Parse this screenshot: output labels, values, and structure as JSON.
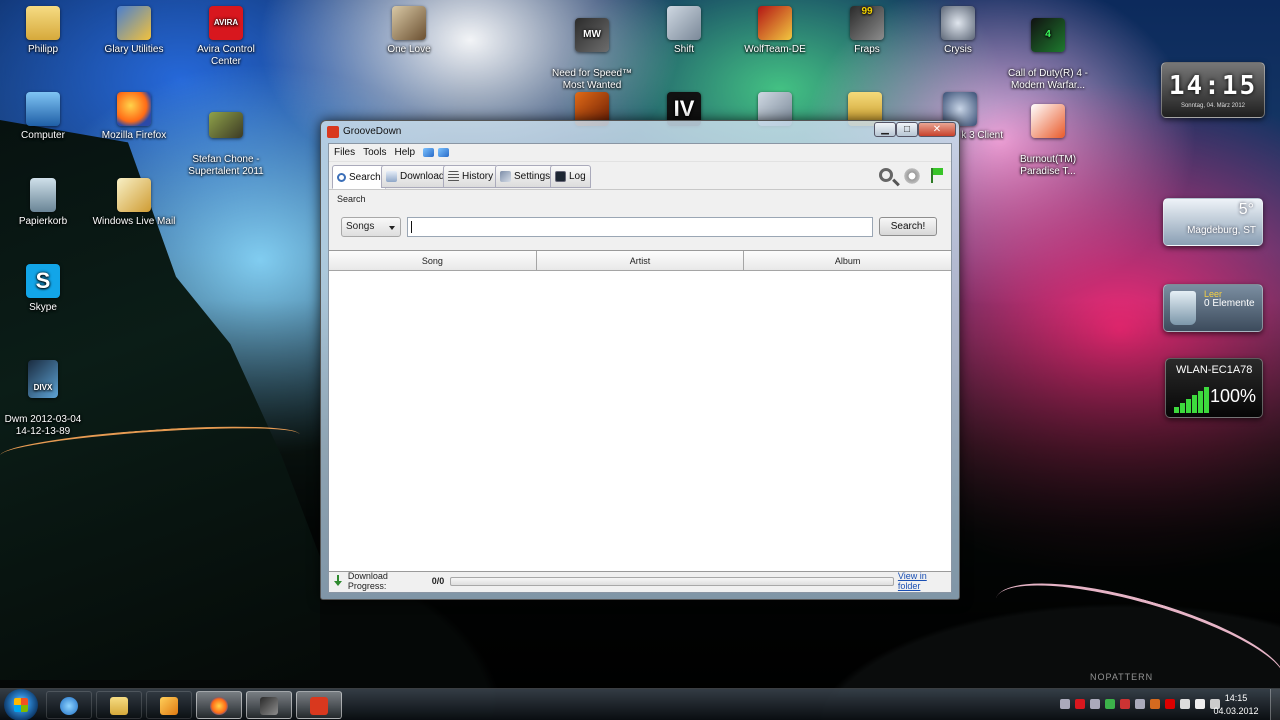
{
  "desktop": {
    "icons": [
      {
        "label": "Philipp",
        "icon": "user-folder-icon"
      },
      {
        "label": "Glary Utilities",
        "icon": "glary-utilities-icon"
      },
      {
        "label": "Avira Control Center",
        "icon": "avira-icon",
        "glyph": "AVIRA"
      },
      {
        "label": "One Love",
        "icon": "music-file-icon"
      },
      {
        "label": "Need for Speed™\nMost Wanted",
        "icon": "nfs-mw-icon",
        "glyph": "MW"
      },
      {
        "label": "Shift",
        "icon": "shift-icon"
      },
      {
        "label": "WolfTeam-DE",
        "icon": "wolfteam-icon"
      },
      {
        "label": "Fraps",
        "icon": "fraps-icon",
        "glyph": "99"
      },
      {
        "label": "Crysis",
        "icon": "crysis-icon"
      },
      {
        "label": "Call of Duty(R) 4 -\nModern Warfar...",
        "icon": "cod4-icon",
        "glyph": "4"
      },
      {
        "label": "Computer",
        "icon": "computer-icon"
      },
      {
        "label": "Mozilla Firefox",
        "icon": "firefox-icon"
      },
      {
        "label": "Stefan Chone -\nSupertalent 2011",
        "icon": "video-file-icon"
      },
      {
        "label": "k 3 Client",
        "icon": "teamspeak-icon"
      },
      {
        "label": "Burnout(TM)\nParadise T...",
        "icon": "burnout-icon"
      },
      {
        "label": "Papierkorb",
        "icon": "recycle-bin-icon"
      },
      {
        "label": "Windows Live Mail",
        "icon": "mail-icon"
      },
      {
        "label": "Skype",
        "icon": "skype-icon",
        "glyph": "S"
      },
      {
        "label": "Dwm 2012-03-04\n14-12-13-89",
        "icon": "divx-icon",
        "glyph": "DIVX"
      }
    ],
    "partial_icons": [
      "game-icon",
      "gta-iv-icon",
      "network-folder-icon",
      "folder-icon"
    ],
    "gta_glyph": "IV",
    "watermark": "NOPATTERN"
  },
  "gadgets": {
    "clock": {
      "time": "14:15",
      "date": "Sonntag, 04. März 2012"
    },
    "weather": {
      "temp": "5°",
      "city": "Magdeburg, ST"
    },
    "recycle": {
      "status": "Leer",
      "count": "0 Elemente"
    },
    "wlan": {
      "ssid": "WLAN-EC1A78",
      "signal": "100%",
      "level": 1.0
    }
  },
  "window": {
    "title": "GrooveDown",
    "controls": {
      "minimize": "▁",
      "maximize": "□",
      "close": "✕"
    },
    "menu": [
      "Files",
      "Tools",
      "Help"
    ],
    "tabs": [
      {
        "label": "Search",
        "icon": "magnifier-icon",
        "active": true
      },
      {
        "label": "Download",
        "icon": "download-icon"
      },
      {
        "label": "History",
        "icon": "list-icon"
      },
      {
        "label": "Settings",
        "icon": "wrench-icon"
      },
      {
        "label": "Log",
        "icon": "console-icon"
      }
    ],
    "search": {
      "section_label": "Search",
      "type_selected": "Songs",
      "query_value": "",
      "button_label": "Search!"
    },
    "table": {
      "columns": [
        "Song",
        "Artist",
        "Album"
      ],
      "rows": []
    },
    "status": {
      "progress_label": "Download Progress:",
      "progress_value": "0/0",
      "progress_fraction": 0,
      "link": "View in folder"
    }
  },
  "taskbar": {
    "pinned": [
      "start-button",
      "ie-icon",
      "explorer-icon",
      "media-player-icon",
      "firefox-icon",
      "fraps-icon",
      "groovedown-icon"
    ],
    "clock_time": "14:15",
    "clock_date": "04.03.2012"
  },
  "colors": {
    "link": "#1a4fb3",
    "close_button": "#c7402b",
    "wlan_signal": "#3dd93d"
  }
}
